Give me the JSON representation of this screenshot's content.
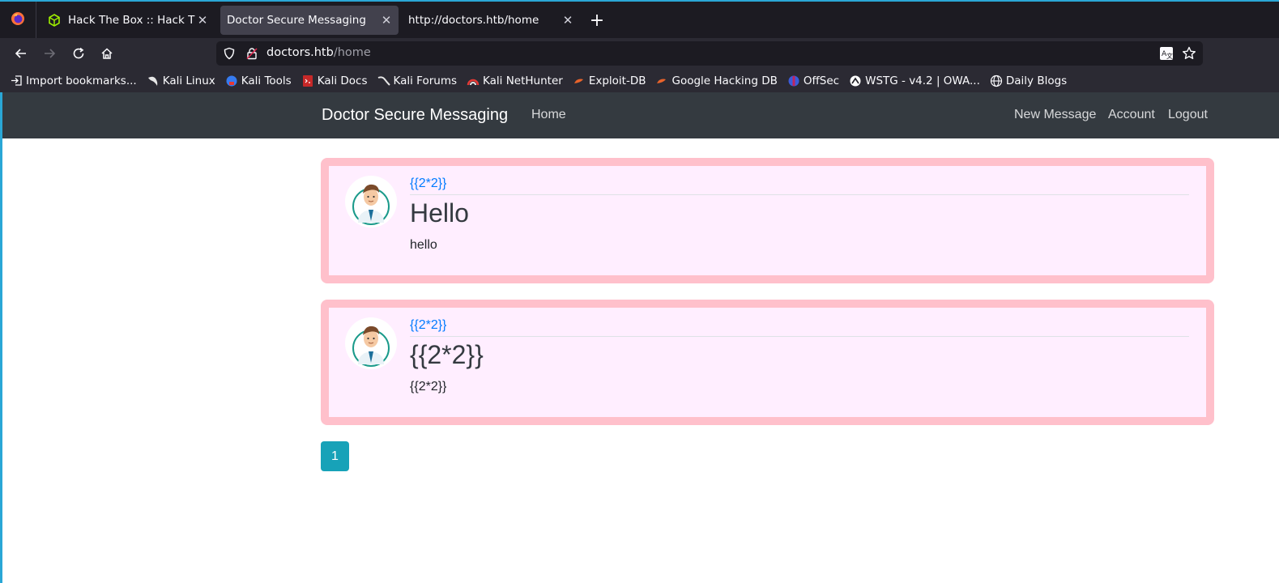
{
  "browser": {
    "tabs": [
      {
        "title": "Hack The Box :: Hack The Box",
        "icon": "htb-cube-icon",
        "active": false
      },
      {
        "title": "Doctor Secure Messaging",
        "icon": "",
        "active": true
      },
      {
        "title": "http://doctors.htb/home",
        "icon": "",
        "active": false
      }
    ],
    "url_host": "doctors.htb",
    "url_path": "/home",
    "bookmarks": [
      {
        "label": "Import bookmarks...",
        "icon": "import-icon"
      },
      {
        "label": "Kali Linux",
        "icon": "kali-dragon-icon"
      },
      {
        "label": "Kali Tools",
        "icon": "kali-tools-icon"
      },
      {
        "label": "Kali Docs",
        "icon": "kali-docs-icon"
      },
      {
        "label": "Kali Forums",
        "icon": "kali-forums-icon"
      },
      {
        "label": "Kali NetHunter",
        "icon": "nethunter-icon"
      },
      {
        "label": "Exploit-DB",
        "icon": "exploit-db-icon"
      },
      {
        "label": "Google Hacking DB",
        "icon": "ghdb-icon"
      },
      {
        "label": "OffSec",
        "icon": "offsec-icon"
      },
      {
        "label": "WSTG - v4.2 | OWA...",
        "icon": "owasp-icon"
      },
      {
        "label": "Daily Blogs",
        "icon": "globe-icon"
      }
    ]
  },
  "site": {
    "brand": "Doctor Secure Messaging",
    "nav_home": "Home",
    "nav_new_message": "New Message",
    "nav_account": "Account",
    "nav_logout": "Logout"
  },
  "posts": [
    {
      "author": "{{2*2}}",
      "title": "Hello",
      "body": "hello"
    },
    {
      "author": "{{2*2}}",
      "title": "{{2*2}}",
      "body": "{{2*2}}"
    }
  ],
  "pagination": {
    "current": "1"
  },
  "colors": {
    "post_border": "#ffc0cb",
    "post_bg": "#ffeeff",
    "navbar": "#343a40",
    "link": "#007bff",
    "page_button": "#17a2b8"
  }
}
